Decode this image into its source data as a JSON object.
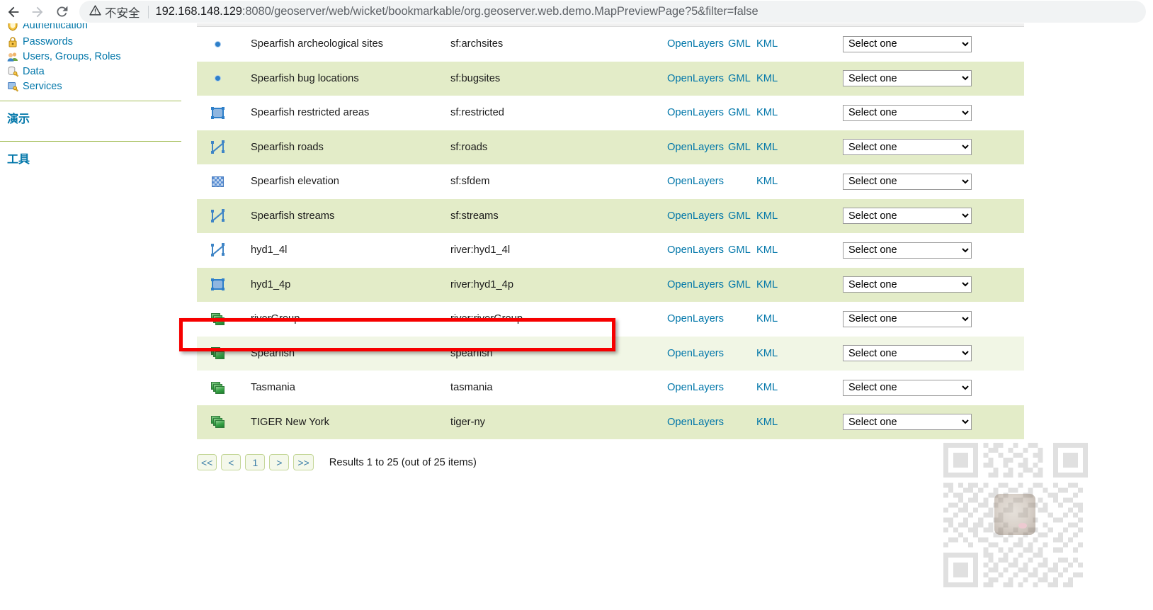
{
  "browser": {
    "back_label": "Back",
    "forward_label": "Forward",
    "reload_label": "Reload",
    "security_warning": "不安全",
    "url_host": "192.168.148.129",
    "url_path": ":8080/geoserver/web/wicket/bookmarkable/org.geoserver.web.demo.MapPreviewPage?5&filter=false",
    "url_full": "192.168.148.129:8080/geoserver/web/wicket/bookmarkable/org.geoserver.web.demo.MapPreviewPage?5&filter=false"
  },
  "sidebar": {
    "links": [
      {
        "label": "Authentication",
        "icon": "shield-icon"
      },
      {
        "label": "Passwords",
        "icon": "padlock-icon"
      },
      {
        "label": "Users, Groups, Roles",
        "icon": "users-icon"
      },
      {
        "label": "Data",
        "icon": "database-key-icon"
      },
      {
        "label": "Services",
        "icon": "services-key-icon"
      }
    ],
    "sections": [
      {
        "title": "演示"
      },
      {
        "title": "工具"
      }
    ]
  },
  "table": {
    "select_placeholder": "Select one",
    "rows": [
      {
        "icon": "point-layer-icon",
        "title": "Spearfish archeological sites",
        "name": "sf:archsites",
        "formats": [
          "OpenLayers",
          "GML",
          "KML"
        ],
        "select": "Select one",
        "stripe": "white",
        "highlighted": false
      },
      {
        "icon": "point-layer-icon",
        "title": "Spearfish bug locations",
        "name": "sf:bugsites",
        "formats": [
          "OpenLayers",
          "GML",
          "KML"
        ],
        "select": "Select one",
        "stripe": "green",
        "highlighted": false
      },
      {
        "icon": "polygon-layer-icon",
        "title": "Spearfish restricted areas",
        "name": "sf:restricted",
        "formats": [
          "OpenLayers",
          "GML",
          "KML"
        ],
        "select": "Select one",
        "stripe": "white",
        "highlighted": false
      },
      {
        "icon": "line-layer-icon",
        "title": "Spearfish roads",
        "name": "sf:roads",
        "formats": [
          "OpenLayers",
          "GML",
          "KML"
        ],
        "select": "Select one",
        "stripe": "green",
        "highlighted": false
      },
      {
        "icon": "raster-layer-icon",
        "title": "Spearfish elevation",
        "name": "sf:sfdem",
        "formats": [
          "OpenLayers",
          "",
          "KML"
        ],
        "select": "Select one",
        "stripe": "white",
        "highlighted": false
      },
      {
        "icon": "line-layer-icon",
        "title": "Spearfish streams",
        "name": "sf:streams",
        "formats": [
          "OpenLayers",
          "GML",
          "KML"
        ],
        "select": "Select one",
        "stripe": "green",
        "highlighted": false
      },
      {
        "icon": "line-layer-icon",
        "title": "hyd1_4l",
        "name": "river:hyd1_4l",
        "formats": [
          "OpenLayers",
          "GML",
          "KML"
        ],
        "select": "Select one",
        "stripe": "white",
        "highlighted": false
      },
      {
        "icon": "polygon-layer-icon",
        "title": "hyd1_4p",
        "name": "river:hyd1_4p",
        "formats": [
          "OpenLayers",
          "GML",
          "KML"
        ],
        "select": "Select one",
        "stripe": "green",
        "highlighted": false
      },
      {
        "icon": "group-layer-icon",
        "title": "riverGroup",
        "name": "river:riverGroup",
        "formats": [
          "OpenLayers",
          "",
          "KML"
        ],
        "select": "Select one",
        "stripe": "white",
        "highlighted": true
      },
      {
        "icon": "group-layer-icon",
        "title": "Spearfish",
        "name": "spearfish",
        "formats": [
          "OpenLayers",
          "",
          "KML"
        ],
        "select": "Select one",
        "stripe": "pale",
        "highlighted": false
      },
      {
        "icon": "group-layer-icon",
        "title": "Tasmania",
        "name": "tasmania",
        "formats": [
          "OpenLayers",
          "",
          "KML"
        ],
        "select": "Select one",
        "stripe": "white",
        "highlighted": false
      },
      {
        "icon": "group-layer-icon",
        "title": "TIGER New York",
        "name": "tiger-ny",
        "formats": [
          "OpenLayers",
          "",
          "KML"
        ],
        "select": "Select one",
        "stripe": "green",
        "highlighted": false
      }
    ]
  },
  "pagination": {
    "buttons": [
      "<<",
      "<",
      "1",
      ">",
      ">>"
    ],
    "results_text": "Results 1 to 25 (out of 25 items)"
  },
  "annotation": {
    "highlight_color": "#f60000",
    "target_row": "riverGroup"
  },
  "colors": {
    "link": "#0076a9",
    "stripe_green": "#e3ecc8",
    "stripe_pale": "#f1f6e5",
    "divider_green": "#a5bf5a",
    "highlight_red": "#f60000"
  },
  "watermark": {
    "type": "qr-code",
    "has_center_avatar": true
  }
}
